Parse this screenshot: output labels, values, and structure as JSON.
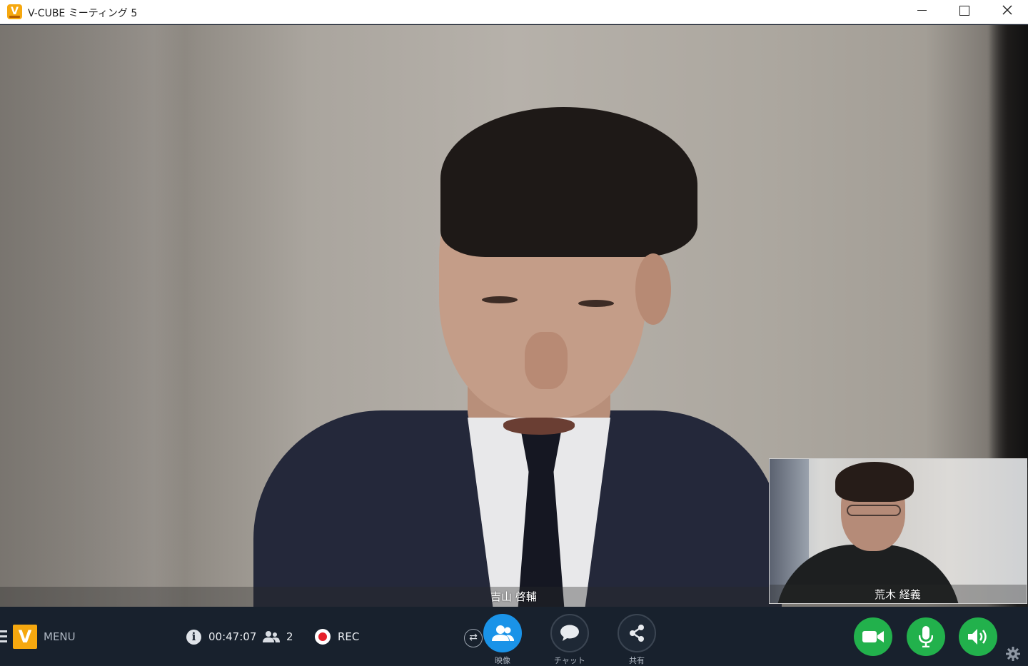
{
  "window": {
    "title": "V-CUBE ミーティング 5"
  },
  "main_video": {
    "participant_name": "吉山 啓輔"
  },
  "pip_video": {
    "participant_name": "荒木 経義"
  },
  "toolbar": {
    "menu_label": "MENU",
    "elapsed_time": "00:47:07",
    "participant_count": "2",
    "rec_label": "REC",
    "video_label": "映像",
    "chat_label": "チャット",
    "share_label": "共有",
    "switch_symbol": "⇄",
    "info_symbol": "i"
  },
  "colors": {
    "accent_blue": "#1a93e8",
    "toggle_green": "#22b14c",
    "rec_red": "#e6202a",
    "brand_orange": "#f6a80f",
    "toolbar_bg": "#18212d"
  },
  "icons": {
    "app": "v-cube-logo-icon",
    "minimize": "minimize-icon",
    "maximize": "maximize-icon",
    "close": "close-icon",
    "info": "info-icon",
    "participants": "participants-icon",
    "rec": "record-icon",
    "switch": "switch-icon",
    "video": "people-icon",
    "chat": "chat-bubble-icon",
    "share": "share-icon",
    "camera": "camera-icon",
    "mic": "microphone-icon",
    "speaker": "speaker-icon",
    "settings": "gear-icon"
  }
}
